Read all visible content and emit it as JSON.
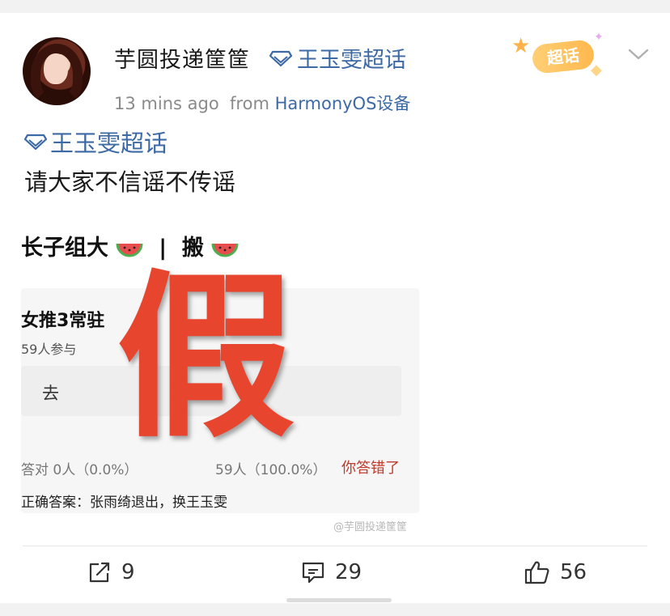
{
  "post": {
    "username": "芋圆投递筐筐",
    "supertopic_tag": "王玉雯超话",
    "time": "13 mins ago",
    "from_label": "from",
    "source": "HarmonyOS设备",
    "badge_label": "超话",
    "topic_link": "王玉雯超话",
    "text": "请大家不信谣不传谣"
  },
  "image": {
    "title_prefix": "长子组大",
    "title_sep": "|",
    "title_suffix": "搬",
    "quiz_title": "女推3常驻",
    "quiz_count": "59人参与",
    "option_text": "去",
    "stat_right": "答对  0人（0.0%）",
    "stat_wrong": "59人（100.0%）",
    "wrong_label": "你答错了",
    "answer": "正确答案：张雨绮退出，换王玉雯",
    "stamp": "假",
    "watermark": "@芋圆投递筐筐"
  },
  "actions": {
    "repost_count": "9",
    "comment_count": "29",
    "like_count": "56"
  },
  "colors": {
    "link_blue": "#3d6aa5",
    "stamp_red": "#e8452f",
    "badge_orange": "#ffb84d"
  }
}
